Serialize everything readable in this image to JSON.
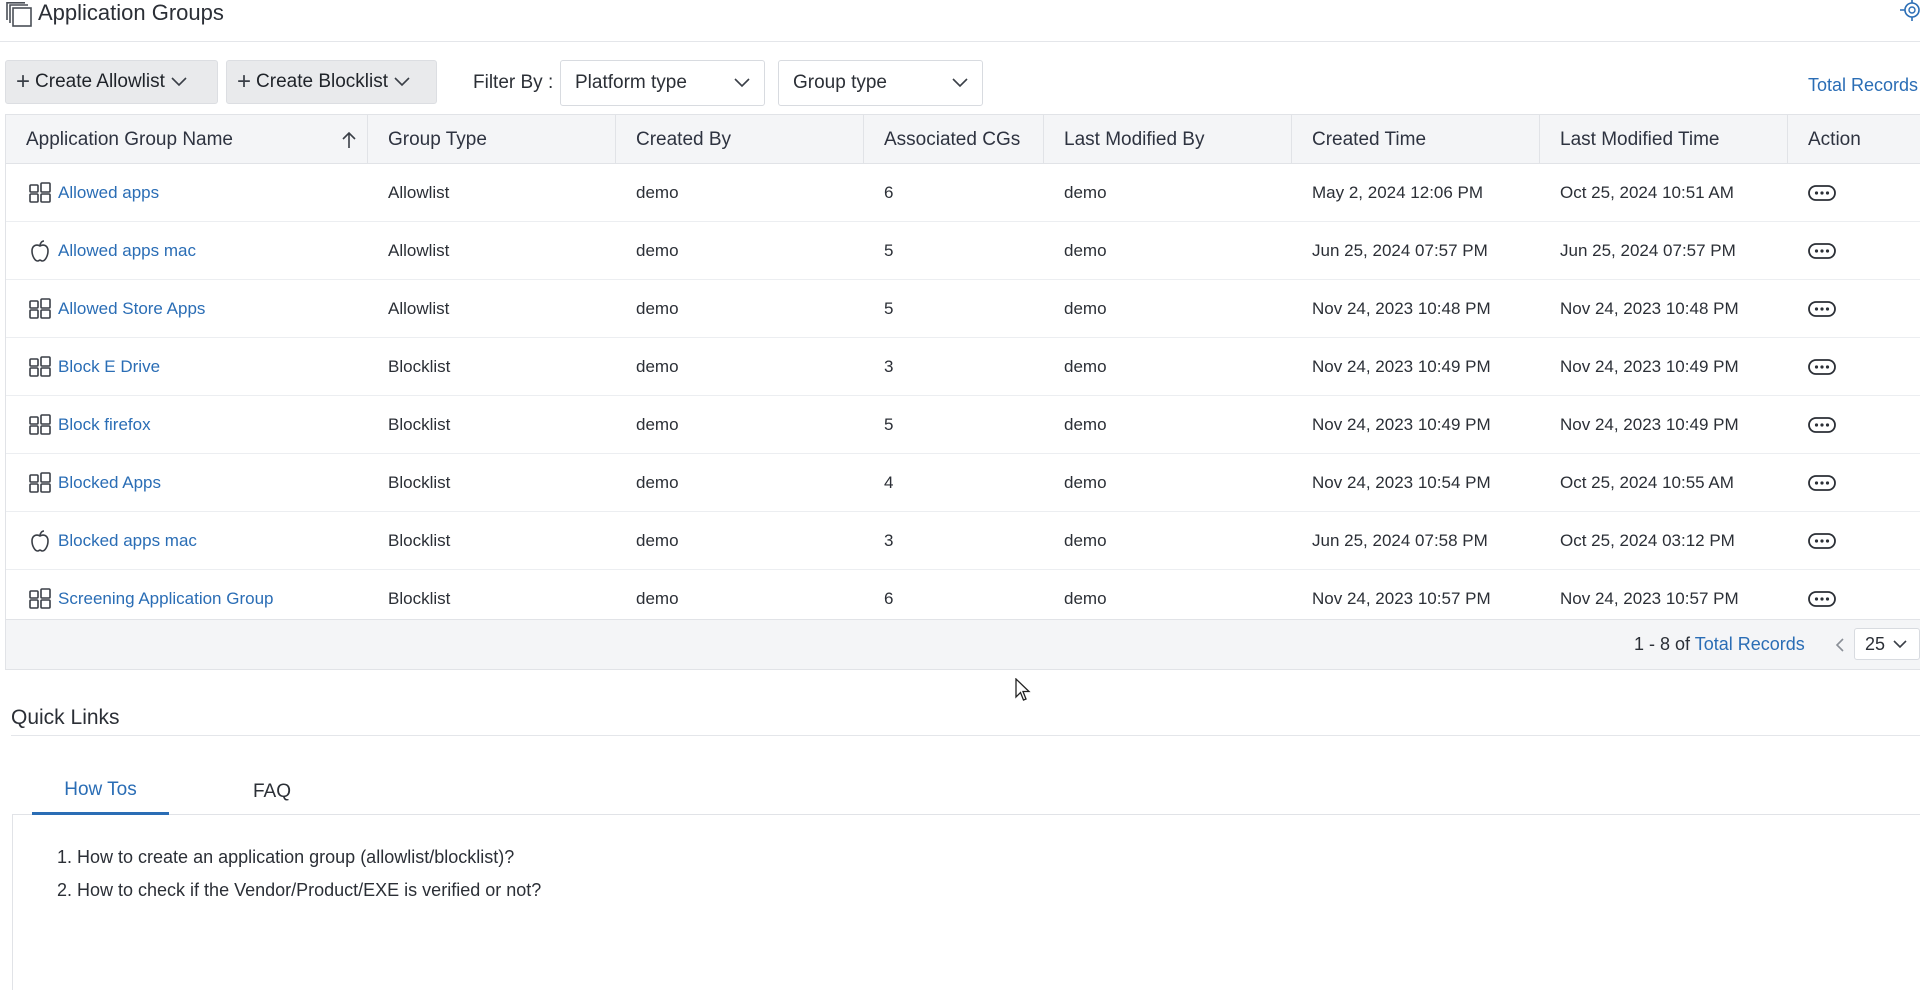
{
  "header": {
    "title": "Application Groups",
    "title_icon": "stacked-pages-icon",
    "settings_icon": "gear-icon"
  },
  "toolbar": {
    "create_allowlist": "Create Allowlist",
    "create_blocklist": "Create Blocklist",
    "filter_label": "Filter By :",
    "platform_filter": "Platform type",
    "group_type_filter": "Group type",
    "total_records": "Total Records"
  },
  "table": {
    "columns": [
      "Application Group Name",
      "Group Type",
      "Created By",
      "Associated CGs",
      "Last Modified By",
      "Created Time",
      "Last Modified Time",
      "Action"
    ],
    "sorted_column": "Application Group Name",
    "sort_direction": "ascending",
    "rows": [
      {
        "os": "windows",
        "name": "Allowed apps",
        "group_type": "Allowlist",
        "created_by": "demo",
        "associated_cgs": "6",
        "last_modified_by": "demo",
        "created_time": "May 2, 2024 12:06 PM",
        "last_modified_time": "Oct 25, 2024 10:51 AM"
      },
      {
        "os": "mac",
        "name": "Allowed apps mac",
        "group_type": "Allowlist",
        "created_by": "demo",
        "associated_cgs": "5",
        "last_modified_by": "demo",
        "created_time": "Jun 25, 2024 07:57 PM",
        "last_modified_time": "Jun 25, 2024 07:57 PM"
      },
      {
        "os": "windows",
        "name": "Allowed Store Apps",
        "group_type": "Allowlist",
        "created_by": "demo",
        "associated_cgs": "5",
        "last_modified_by": "demo",
        "created_time": "Nov 24, 2023 10:48 PM",
        "last_modified_time": "Nov 24, 2023 10:48 PM"
      },
      {
        "os": "windows",
        "name": "Block E Drive",
        "group_type": "Blocklist",
        "created_by": "demo",
        "associated_cgs": "3",
        "last_modified_by": "demo",
        "created_time": "Nov 24, 2023 10:49 PM",
        "last_modified_time": "Nov 24, 2023 10:49 PM"
      },
      {
        "os": "windows",
        "name": "Block firefox",
        "group_type": "Blocklist",
        "created_by": "demo",
        "associated_cgs": "5",
        "last_modified_by": "demo",
        "created_time": "Nov 24, 2023 10:49 PM",
        "last_modified_time": "Nov 24, 2023 10:49 PM"
      },
      {
        "os": "windows",
        "name": "Blocked Apps",
        "group_type": "Blocklist",
        "created_by": "demo",
        "associated_cgs": "4",
        "last_modified_by": "demo",
        "created_time": "Nov 24, 2023 10:54 PM",
        "last_modified_time": "Oct 25, 2024 10:55 AM"
      },
      {
        "os": "mac",
        "name": "Blocked apps mac",
        "group_type": "Blocklist",
        "created_by": "demo",
        "associated_cgs": "3",
        "last_modified_by": "demo",
        "created_time": "Jun 25, 2024 07:58 PM",
        "last_modified_time": "Oct 25, 2024 03:12 PM"
      },
      {
        "os": "windows",
        "name": "Screening Application Group",
        "group_type": "Blocklist",
        "created_by": "demo",
        "associated_cgs": "6",
        "last_modified_by": "demo",
        "created_time": "Nov 24, 2023 10:57 PM",
        "last_modified_time": "Nov 24, 2023 10:57 PM"
      }
    ]
  },
  "pager": {
    "range": "1 - 8 of",
    "total_link": "Total Records",
    "page_size": "25"
  },
  "quick_links": {
    "title": "Quick Links",
    "tabs": [
      "How Tos",
      "FAQ"
    ],
    "active_tab": "How Tos",
    "items": [
      "1. How to create an application group (allowlist/blocklist)?",
      "2. How to check if the Vendor/Product/EXE is verified or not?"
    ]
  },
  "colors": {
    "link": "#2a6db5",
    "header_bg": "#f4f5f7",
    "button_bg": "#e9eaec"
  }
}
